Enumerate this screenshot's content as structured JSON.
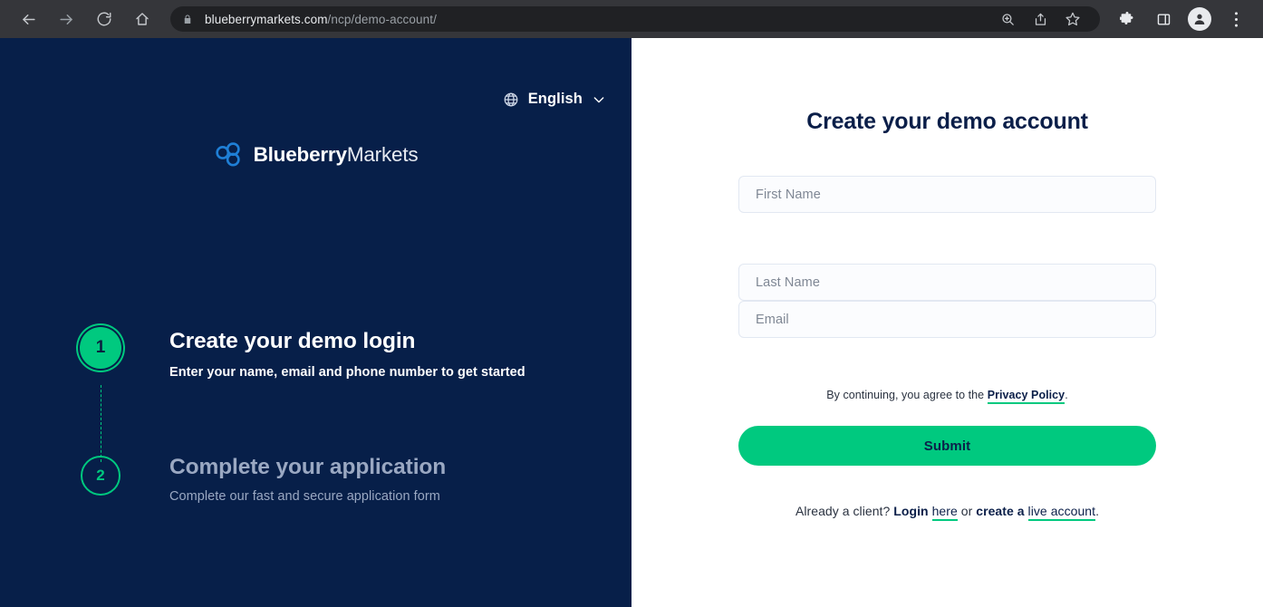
{
  "browser": {
    "back_icon": "back-arrow-icon",
    "forward_icon": "forward-arrow-icon",
    "reload_icon": "reload-icon",
    "home_icon": "home-icon",
    "lock_icon": "lock-icon",
    "url_domain": "blueberrymarkets.com",
    "url_path": "/ncp/demo-account/",
    "zoom_icon": "zoom-search-icon",
    "share_icon": "share-icon",
    "bookmark_icon": "star-bookmark-icon",
    "extensions_icon": "puzzle-extensions-icon",
    "sidepanel_icon": "side-panel-icon",
    "profile_icon": "profile-avatar-icon",
    "menu_icon": "three-dot-menu-icon"
  },
  "left": {
    "language": {
      "globe_icon": "globe-icon",
      "label": "English",
      "chevron_icon": "chevron-down-icon"
    },
    "brand": {
      "mark_icon": "blueberry-circles-logo-icon",
      "name_bold": "Blueberry",
      "name_light": "Markets"
    },
    "steps": [
      {
        "number": "1",
        "title": "Create your demo login",
        "subtitle": "Enter your name, email and phone number to get started",
        "state": "active"
      },
      {
        "number": "2",
        "title": "Complete your application",
        "subtitle": "Complete our fast and secure application form",
        "state": "inactive"
      }
    ]
  },
  "right": {
    "title": "Create your demo account",
    "fields": [
      {
        "name": "first-name",
        "placeholder": "First Name",
        "value": ""
      },
      {
        "name": "last-name",
        "placeholder": "Last Name",
        "value": ""
      },
      {
        "name": "email",
        "placeholder": "Email",
        "value": ""
      }
    ],
    "policy": {
      "prefix": "By continuing, you agree to the ",
      "link": "Privacy Policy",
      "suffix": "."
    },
    "submit_label": "Submit",
    "login": {
      "prefix": "Already a client? ",
      "bold1": "Login",
      "link1": "here",
      "mid": " or ",
      "bold2": "create a",
      "link2": "live account",
      "suffix": "."
    }
  },
  "colors": {
    "navy": "#071f49",
    "green": "#00c97f",
    "brand_blue": "#1d7fd4",
    "text_dark": "#0b1f49",
    "muted": "#9aa8c2",
    "chrome_bg": "#35363a",
    "omnibox_bg": "#202124"
  }
}
